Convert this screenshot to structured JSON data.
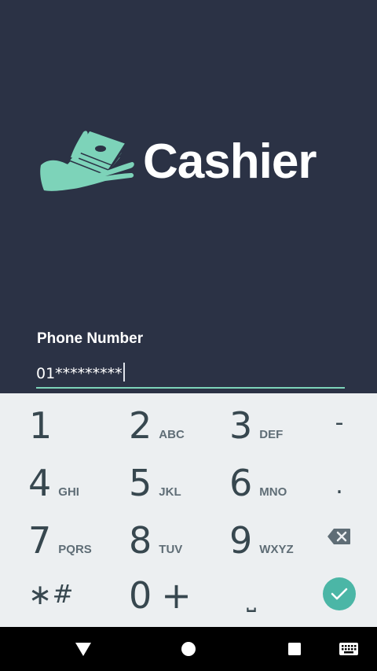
{
  "app": {
    "brand_name": "Cashier",
    "logo_icon": "hand-holding-cash-icon",
    "accent_color": "#7dd3b9",
    "background_color": "#2b3245"
  },
  "form": {
    "phone_label": "Phone Number",
    "phone_value": "01*********"
  },
  "keypad": {
    "keys": [
      {
        "num": "1",
        "letters": ""
      },
      {
        "num": "2",
        "letters": "ABC"
      },
      {
        "num": "3",
        "letters": "DEF"
      },
      {
        "num": "4",
        "letters": "GHI"
      },
      {
        "num": "5",
        "letters": "JKL"
      },
      {
        "num": "6",
        "letters": "MNO"
      },
      {
        "num": "7",
        "letters": "PQRS"
      },
      {
        "num": "8",
        "letters": "TUV"
      },
      {
        "num": "9",
        "letters": "WXYZ"
      },
      {
        "num": "0",
        "letters": "+"
      }
    ],
    "minus": "-",
    "dot": ".",
    "star": "∗",
    "hash": "#",
    "space": "⎵",
    "backspace_icon": "backspace-icon",
    "done_icon": "check-icon",
    "done_color": "#4bb6a6"
  },
  "navbar": {
    "back_icon": "back-triangle-icon",
    "home_icon": "home-circle-icon",
    "recents_icon": "recents-square-icon",
    "keyboard_icon": "keyboard-icon"
  }
}
